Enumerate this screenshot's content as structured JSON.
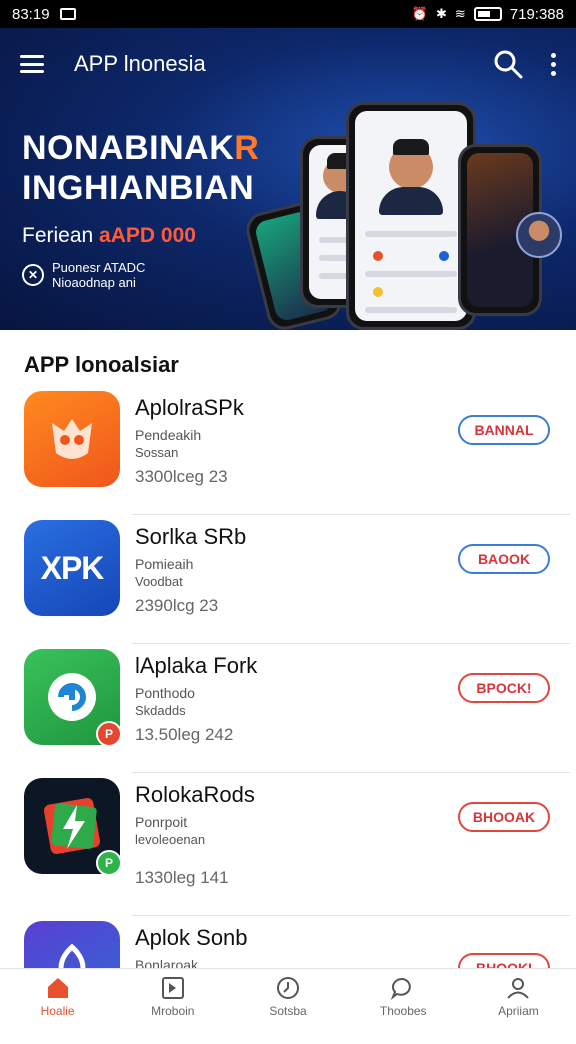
{
  "status_bar": {
    "time": "83:19",
    "right_text": "719:388"
  },
  "app_bar": {
    "title": "APP lnonesia"
  },
  "hero": {
    "headline_line1_main": "NONABINAK",
    "headline_line1_accent": "R",
    "headline_line2": "INGHIANBIAN",
    "subline_text": "Feriean ",
    "subline_accent": "aAPD 000",
    "brand_line1": "Puonesr ATADC",
    "brand_line2": "Nioaodnap ani"
  },
  "section": {
    "title": "APP lonoalsiar"
  },
  "apps": [
    {
      "name": "AplolraSPk",
      "meta1": "Pendeakih",
      "meta2": "Sossan",
      "size": "3300lceg 23",
      "button": "BANNAL",
      "icon_text": "",
      "icon_color": "#f26a1b"
    },
    {
      "name": "Sorlka SRb",
      "meta1": "Pomieaih",
      "meta2": "Voodbat",
      "size": "2390lcg 23",
      "button": "BAOOK",
      "icon_text": "XPK",
      "icon_color": "#1e5fd4"
    },
    {
      "name": "lAplaka Fork",
      "meta1": "Ponthodo",
      "meta2": "Skdadds",
      "size": "13.50leg 242",
      "button": "BPOCK!",
      "icon_text": "",
      "icon_color": "#2db34a"
    },
    {
      "name": "RolokaRods",
      "meta1": "Ponrpoit",
      "meta2": "levoleoenan",
      "size": "1330leg 141",
      "button": "BHOOAK",
      "icon_text": "",
      "icon_color": "#101820"
    },
    {
      "name": "Aplok Sonb",
      "meta1": "Bonlaroak",
      "meta2": "",
      "size": "",
      "button": "BHOOKI",
      "icon_text": "",
      "icon_color": "#3b3fc4"
    }
  ],
  "bottom_nav": [
    {
      "label": "Hoalie",
      "icon": "home-icon",
      "active": true
    },
    {
      "label": "Mroboin",
      "icon": "media-icon",
      "active": false
    },
    {
      "label": "Sotsba",
      "icon": "clock-icon",
      "active": false
    },
    {
      "label": "Thoobes",
      "icon": "chat-icon",
      "active": false
    },
    {
      "label": "Apriiam",
      "icon": "person-icon",
      "active": false
    }
  ],
  "colors": {
    "accent": "#e8502e",
    "hero_bg": "#0d2769",
    "button_border": "#3c7bd6",
    "button_text": "#d8343c"
  }
}
